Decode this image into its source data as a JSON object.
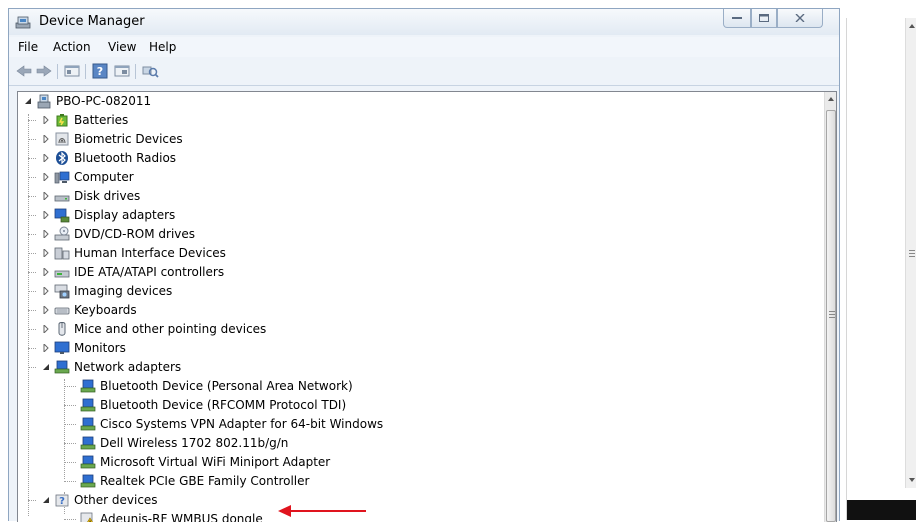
{
  "window": {
    "title": "Device Manager"
  },
  "menu": [
    "File",
    "Action",
    "View",
    "Help"
  ],
  "tree": {
    "root": "PBO-PC-082011",
    "categories": [
      {
        "label": "Batteries",
        "icon": "battery-icon",
        "expanded": false
      },
      {
        "label": "Biometric Devices",
        "icon": "fingerprint-icon",
        "expanded": false
      },
      {
        "label": "Bluetooth Radios",
        "icon": "bluetooth-icon",
        "expanded": false
      },
      {
        "label": "Computer",
        "icon": "computer-icon",
        "expanded": false
      },
      {
        "label": "Disk drives",
        "icon": "disk-drive-icon",
        "expanded": false
      },
      {
        "label": "Display adapters",
        "icon": "display-adapter-icon",
        "expanded": false
      },
      {
        "label": "DVD/CD-ROM drives",
        "icon": "dvd-drive-icon",
        "expanded": false
      },
      {
        "label": "Human Interface Devices",
        "icon": "hid-icon",
        "expanded": false
      },
      {
        "label": "IDE ATA/ATAPI controllers",
        "icon": "ide-controller-icon",
        "expanded": false
      },
      {
        "label": "Imaging devices",
        "icon": "camera-icon",
        "expanded": false
      },
      {
        "label": "Keyboards",
        "icon": "keyboard-icon",
        "expanded": false
      },
      {
        "label": "Mice and other pointing devices",
        "icon": "mouse-icon",
        "expanded": false
      },
      {
        "label": "Monitors",
        "icon": "monitor-icon",
        "expanded": false
      },
      {
        "label": "Network adapters",
        "icon": "network-adapter-icon",
        "expanded": true,
        "children": [
          "Bluetooth Device (Personal Area Network)",
          "Bluetooth Device (RFCOMM Protocol TDI)",
          "Cisco Systems VPN Adapter for 64-bit Windows",
          "Dell Wireless 1702 802.11b/g/n",
          "Microsoft Virtual WiFi Miniport Adapter",
          "Realtek PCIe GBE Family Controller"
        ]
      },
      {
        "label": "Other devices",
        "icon": "unknown-device-icon",
        "expanded": true,
        "children": [
          "Adeunis-RF WMBUS dongle"
        ]
      }
    ]
  },
  "colors": {
    "annotation_arrow": "#e0141e",
    "warning": "#f2c40f",
    "accent": "#2f6fd1"
  }
}
